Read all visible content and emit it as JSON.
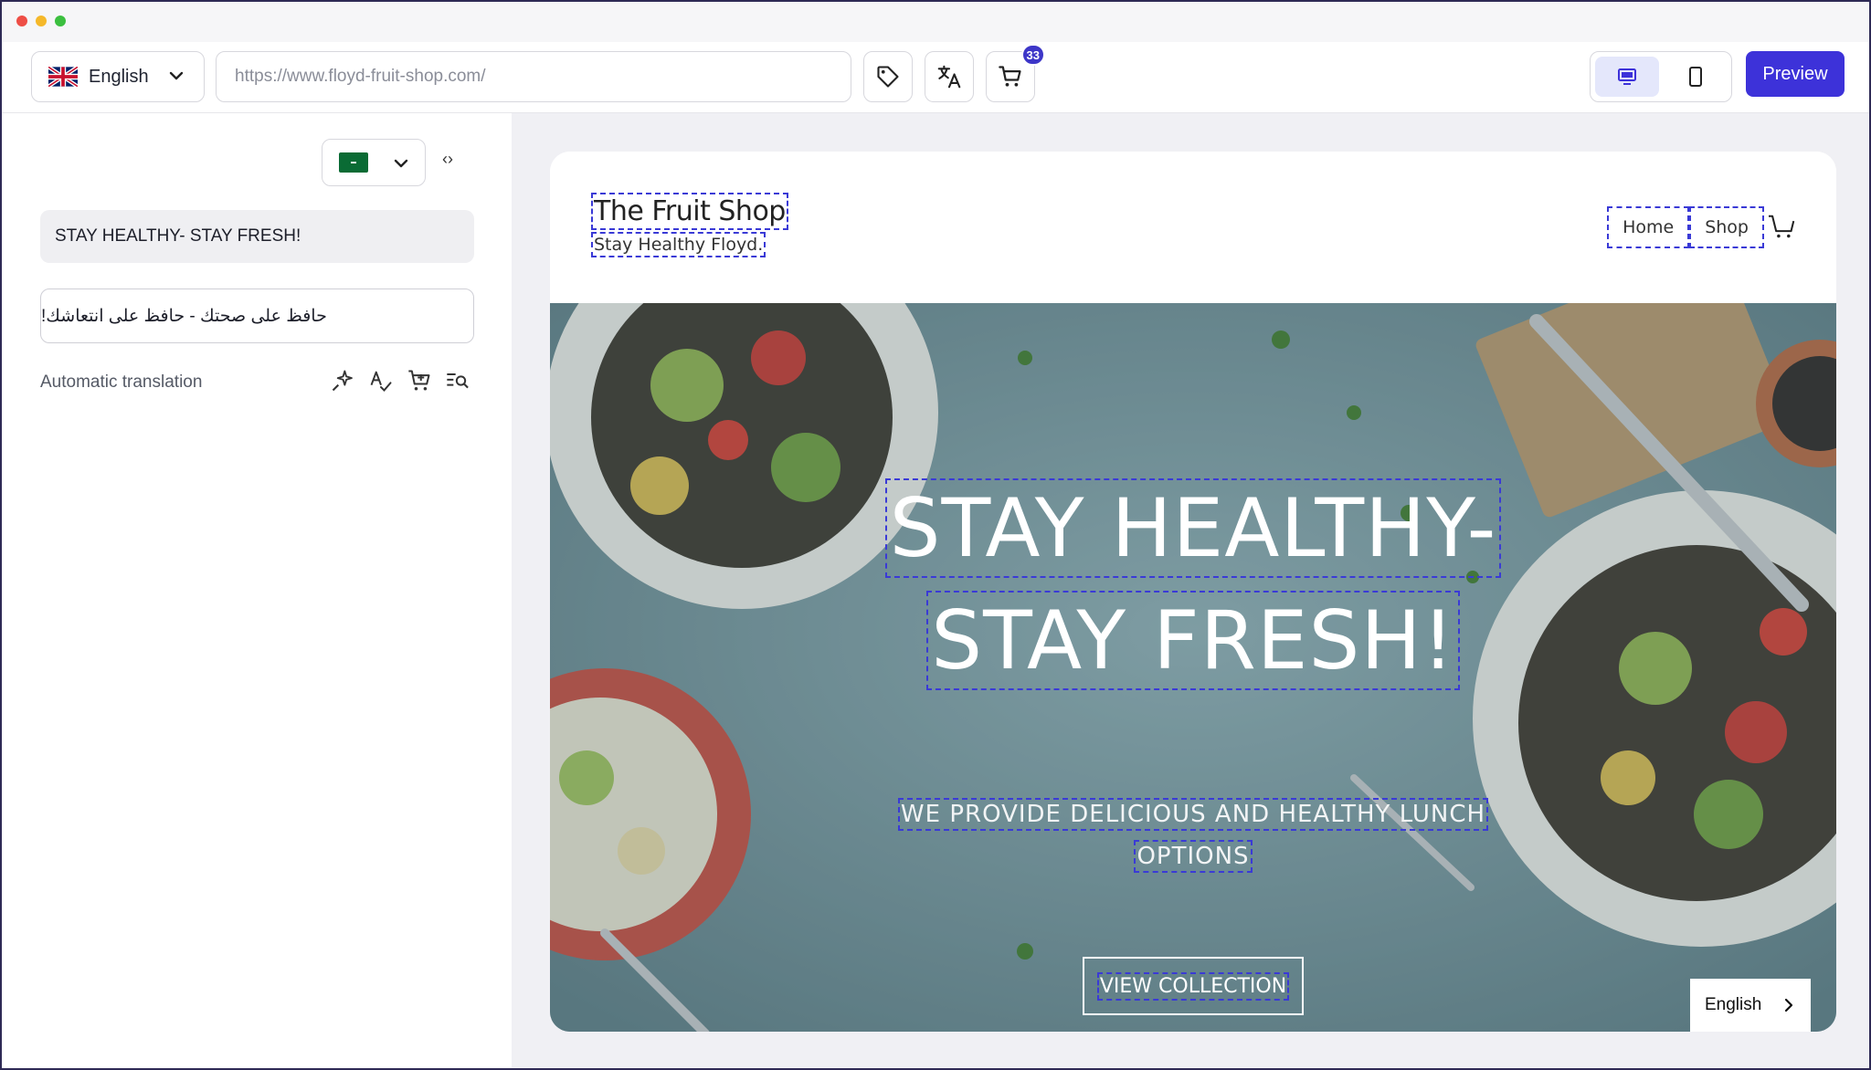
{
  "toolbar": {
    "language_label": "English",
    "url_value": "https://www.floyd-fruit-shop.com/",
    "cart_badge": "33",
    "preview_label": "Preview"
  },
  "editor": {
    "source_text": "STAY HEALTHY- STAY FRESH!",
    "translated_text": "حافظ على صحتك - حافظ على انتعاشك!",
    "auto_translation_label": "Automatic translation"
  },
  "site": {
    "title": "The Fruit Shop",
    "tagline": "Stay Healthy Floyd.",
    "nav": [
      "Home",
      "Shop"
    ],
    "hero_line1": "STAY HEALTHY-",
    "hero_line2": "STAY FRESH!",
    "hero_sub1": "WE PROVIDE DELICIOUS AND HEALTHY LUNCH",
    "hero_sub2": "OPTIONS",
    "cta_label": "VIEW COLLECTION",
    "language_switch": "English"
  },
  "colors": {
    "accent": "#3d32d9",
    "badge": "#3d36c8",
    "outline_dash": "#3a3ad6"
  }
}
